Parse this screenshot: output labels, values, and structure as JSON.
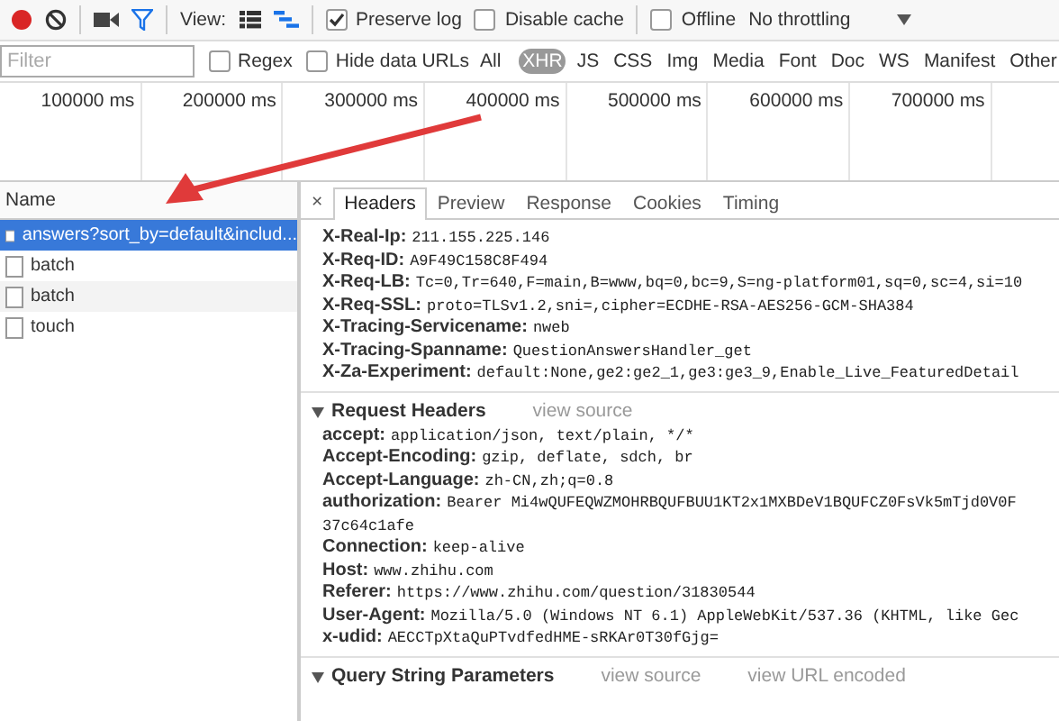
{
  "toolbar": {
    "view_label": "View:",
    "checkboxes": [
      {
        "label": "Preserve log",
        "checked": true
      },
      {
        "label": "Disable cache",
        "checked": false
      },
      {
        "label": "Offline",
        "checked": false
      }
    ],
    "throttling": "No throttling"
  },
  "filter_bar": {
    "placeholder": "Filter",
    "options": [
      {
        "label": "Regex",
        "checked": false
      },
      {
        "label": "Hide data URLs",
        "checked": false
      }
    ],
    "types": [
      {
        "label": "All",
        "selected": false
      },
      {
        "label": "XHR",
        "selected": true
      },
      {
        "label": "JS",
        "selected": false
      },
      {
        "label": "CSS",
        "selected": false
      },
      {
        "label": "Img",
        "selected": false
      },
      {
        "label": "Media",
        "selected": false
      },
      {
        "label": "Font",
        "selected": false
      },
      {
        "label": "Doc",
        "selected": false
      },
      {
        "label": "WS",
        "selected": false
      },
      {
        "label": "Manifest",
        "selected": false
      },
      {
        "label": "Other",
        "selected": false
      }
    ]
  },
  "timeline": {
    "ticks": [
      "100000 ms",
      "200000 ms",
      "300000 ms",
      "400000 ms",
      "500000 ms",
      "600000 ms",
      "700000 ms"
    ]
  },
  "requests": {
    "column": "Name",
    "rows": [
      {
        "name": "answers?sort_by=default&includ...",
        "selected": true
      },
      {
        "name": "batch",
        "selected": false
      },
      {
        "name": "batch",
        "selected": false
      },
      {
        "name": "touch",
        "selected": false
      }
    ]
  },
  "details": {
    "close": "×",
    "tabs": [
      {
        "label": "Headers",
        "selected": true
      },
      {
        "label": "Preview",
        "selected": false
      },
      {
        "label": "Response",
        "selected": false
      },
      {
        "label": "Cookies",
        "selected": false
      },
      {
        "label": "Timing",
        "selected": false
      }
    ],
    "sections": [
      {
        "kind": "continued",
        "headers": [
          {
            "name": "X-Real-Ip:",
            "value": [
              "211.155.225.146"
            ]
          },
          {
            "name": "X-Req-ID:",
            "value": [
              "A9F49C158C8F494"
            ]
          },
          {
            "name": "X-Req-LB:",
            "value": [
              "Tc=0,Tr=640,F=main,B=www,bq=0,bc=9,S=ng-platform01,sq=0,sc=4,si=10"
            ]
          },
          {
            "name": "X-Req-SSL:",
            "value": [
              "proto=TLSv1.2,sni=,cipher=ECDHE-RSA-AES256-GCM-SHA384"
            ]
          },
          {
            "name": "X-Tracing-Servicename:",
            "value": [
              "nweb"
            ]
          },
          {
            "name": "X-Tracing-Spanname:",
            "value": [
              "QuestionAnswersHandler_get"
            ]
          },
          {
            "name": "X-Za-Experiment:",
            "value": [
              "default:None,ge2:ge2_1,ge3:ge3_9,Enable_Live_FeaturedDetail"
            ]
          }
        ]
      },
      {
        "kind": "titled",
        "title": "Request Headers",
        "expanded": true,
        "links": [
          "view source"
        ],
        "headers": [
          {
            "name": "accept:",
            "value": [
              "application/json, text/plain, */*"
            ]
          },
          {
            "name": "Accept-Encoding:",
            "value": [
              "gzip, deflate, sdch, br"
            ]
          },
          {
            "name": "Accept-Language:",
            "value": [
              "zh-CN,zh;q=0.8"
            ]
          },
          {
            "name": "authorization:",
            "value": [
              "Bearer Mi4wQUFEQWZMOHRBQUFBUU1KT2x1MXBDeV1BQUFCZ0FsVk5mTjd0V0F",
              "37c64c1afe"
            ]
          },
          {
            "name": "Connection:",
            "value": [
              "keep-alive"
            ]
          },
          {
            "name": "Host:",
            "value": [
              "www.zhihu.com"
            ]
          },
          {
            "name": "Referer:",
            "value": [
              "https://www.zhihu.com/question/31830544"
            ]
          },
          {
            "name": "User-Agent:",
            "value": [
              "Mozilla/5.0 (Windows NT 6.1) AppleWebKit/537.36 (KHTML, like Gec"
            ]
          },
          {
            "name": "x-udid:",
            "value": [
              "AECCTpXtaQuPTvdfedHME-sRKAr0T30fGjg="
            ]
          }
        ]
      },
      {
        "kind": "titled",
        "title": "Query String Parameters",
        "expanded": true,
        "links": [
          "view source",
          "view URL encoded"
        ]
      }
    ]
  }
}
